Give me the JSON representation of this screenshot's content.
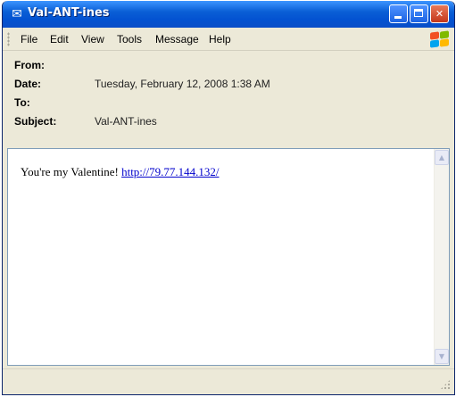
{
  "window": {
    "title": "Val-ANT-ines",
    "icon": "envelope-icon",
    "controls": {
      "minimize": "minimize",
      "maximize": "maximize",
      "close": "✕"
    }
  },
  "menu": {
    "items": [
      {
        "label": "File"
      },
      {
        "label": "Edit"
      },
      {
        "label": "View"
      },
      {
        "label": "Tools"
      },
      {
        "label": "Message"
      },
      {
        "label": "Help"
      }
    ]
  },
  "header": {
    "from_label": "From:",
    "from_value": "",
    "date_label": "Date:",
    "date_value": "Tuesday, February 12, 2008 1:38 AM",
    "to_label": "To:",
    "to_value": "",
    "subject_label": "Subject:",
    "subject_value": "Val-ANT-ines"
  },
  "message": {
    "text": "You're my Valentine! ",
    "link": "http://79.77.144.132/"
  },
  "colors": {
    "titlebar": "#0a5fd6",
    "window_bg": "#ece9d8",
    "link": "#0000cc",
    "close_button": "#c4371b"
  }
}
